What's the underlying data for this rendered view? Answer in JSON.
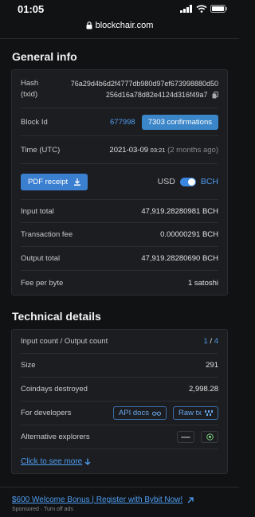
{
  "status_bar": {
    "time": "01:05"
  },
  "browser": {
    "url": "blockchair.com"
  },
  "general": {
    "title": "General info",
    "hash_label": "Hash",
    "txid_label": "(txid)",
    "hash_line1": "76a29d4b6d2f4777db980d97ef673998880d50",
    "hash_line2": "256d16a78d82e4124d316f49a7",
    "block_label": "Block Id",
    "block_value": "677998",
    "confirmations": "7303 confirmations",
    "time_label": "Time (UTC)",
    "time_value": "2021-03-09",
    "time_clock": "03:21",
    "time_ago": "(2 months ago)",
    "pdf_label": "PDF receipt",
    "currency_left": "USD",
    "currency_right": "BCH",
    "input_total_label": "Input total",
    "input_total_main": "47,919.",
    "input_total_dec": "28280981",
    "input_total_unit": "BCH",
    "fee_label": "Transaction fee",
    "fee_main": "0.",
    "fee_dec": "00000291",
    "fee_unit": "BCH",
    "output_total_label": "Output total",
    "output_total_main": "47,919.",
    "output_total_dec": "28280690",
    "output_total_unit": "BCH",
    "fee_per_byte_label": "Fee per byte",
    "fee_per_byte_value": "1 satoshi"
  },
  "technical": {
    "title": "Technical details",
    "io_label": "Input count / Output count",
    "input_count": "1",
    "io_sep": "/",
    "output_count": "4",
    "size_label": "Size",
    "size_value": "291",
    "coindays_label": "Coindays destroyed",
    "coindays_value": "2,998.28",
    "dev_label": "For developers",
    "api_docs": "API docs",
    "raw_tx": "Raw tx",
    "alt_label": "Alternative explorers",
    "see_more": "Click to see more"
  },
  "footer": {
    "bonus": "$600 Welcome Bonus | Register with Bybit Now!",
    "sponsored": "Sponsored · Turn off ads"
  },
  "colors": {
    "accent": "#4e9df0",
    "badge": "#3b86c9",
    "background": "#111214",
    "panel": "#1c1d20"
  },
  "icons": [
    "signal-icon",
    "wifi-icon",
    "battery-icon",
    "lock-icon",
    "copy-icon",
    "download-icon",
    "glasses-icon",
    "binary-icon",
    "btc-badge-icon",
    "explorer-badge-icon",
    "arrow-down-icon",
    "external-arrow-icon"
  ]
}
